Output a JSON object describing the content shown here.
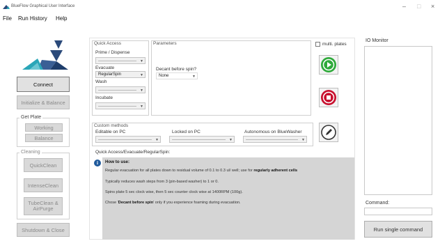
{
  "window": {
    "title": "BlueFlow Graphical User Interface",
    "minimize": "–",
    "maximize": "□",
    "close": "×"
  },
  "menu": {
    "items": [
      "File",
      "Run History",
      "Help"
    ]
  },
  "left": {
    "connect": "Connect",
    "init_balance": "Initialize & Balance",
    "get_plate": {
      "label": "Get Plate",
      "working": "Working",
      "balance": "Balance"
    },
    "cleaning": {
      "label": "Cleaning",
      "quick": "QuickClean",
      "intense": "IntenseClean",
      "tube": "TubeClean &\nAirPurge"
    },
    "shutdown": "Shutdown & Close"
  },
  "quick_access": {
    "title": "Quick Access",
    "prime_label": "Prime / Dispense",
    "evacuate_label": "Evacuate",
    "evacuate_value": "RegularSpin",
    "wash_label": "Wash",
    "incubate_label": "Incubate"
  },
  "parameters": {
    "title": "Parameters",
    "decant_label": "Decant before spin?",
    "decant_value": "None"
  },
  "multi_plates": {
    "label": "multi. plates",
    "checked": false
  },
  "custom_methods": {
    "title": "Custom methods",
    "editable": "Editable on PC",
    "locked": "Locked on PC",
    "autonomous": "Autonomous on BlueWasher"
  },
  "info": {
    "path": "Quick Access/Evacuate/RegularSpin:",
    "heading": "How to use:",
    "line1_prefix": "Regular evacuation for all plates down to residual volume of 0.1 to 0.3 ul/ well; use for ",
    "line1_bold": "regularly adherent cells",
    "line2": "Typically reduces wash steps from 3 (pin-based washer) to 1 or 0.",
    "line3": "Spins plate 5 sec clock wise, then 5 sec counter clock wise at 1400RPM (100g).",
    "line4_prefix": "Chose '",
    "line4_bold": "Decant before spin",
    "line4_suffix": "' only if you experience foaming during evacuation."
  },
  "right": {
    "io_monitor": "IO Monitor",
    "command_label": "Command:",
    "command_value": "",
    "run_single": "Run single command"
  },
  "icons": {
    "play": "play-icon",
    "stop": "stop-icon",
    "edit": "pencil-icon",
    "info": "info-icon"
  },
  "colors": {
    "play_green": "#2eaa3a",
    "stop_red": "#c8102e",
    "logo_dark": "#2b4a7a",
    "logo_teal": "#2aa6b8",
    "info_blue": "#1f5a9c"
  }
}
